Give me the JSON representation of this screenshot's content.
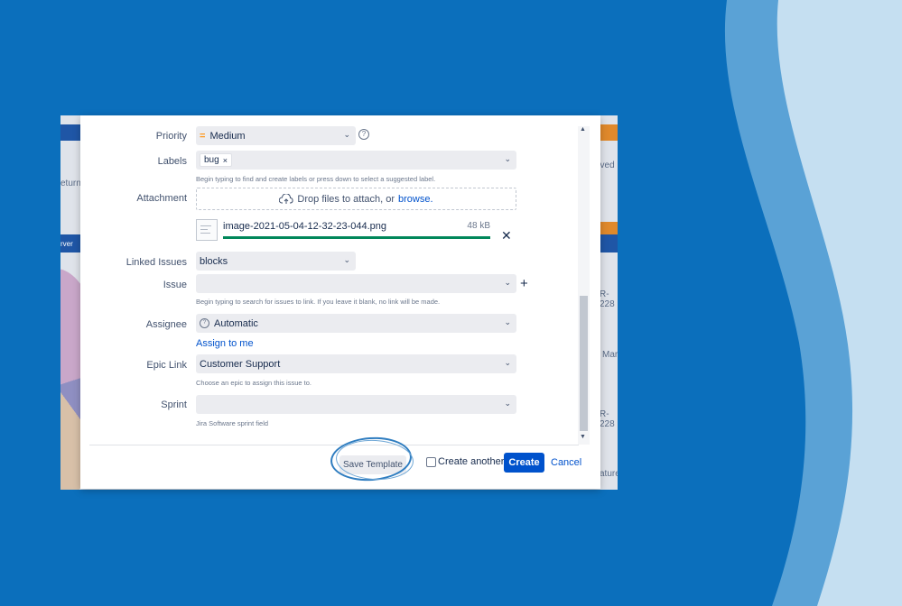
{
  "colors": {
    "background": "#0b6fbc",
    "accent": "#0052cc",
    "progress": "#00875a"
  },
  "background_app": {
    "snippets": [
      "eturn",
      "rver",
      "eved",
      "R-228",
      "Marl",
      "R-228",
      "ature"
    ]
  },
  "form": {
    "priority": {
      "label": "Priority",
      "value": "Medium",
      "icon": "priority-medium-icon"
    },
    "labels": {
      "label": "Labels",
      "tag": "bug",
      "tag_remove": "×",
      "hint": "Begin typing to find and create labels or press down to select a suggested label."
    },
    "attachment": {
      "label": "Attachment",
      "drop_text": "Drop files to attach, or",
      "browse": "browse.",
      "file": {
        "name": "image-2021-05-04-12-32-23-044.png",
        "size": "48 kB",
        "progress": 1.0
      },
      "remove": "✕"
    },
    "linked_issues": {
      "label": "Linked Issues",
      "value": "blocks"
    },
    "issue": {
      "label": "Issue",
      "value": "",
      "hint": "Begin typing to search for issues to link. If you leave it blank, no link will be made.",
      "add": "+"
    },
    "assignee": {
      "label": "Assignee",
      "value": "Automatic",
      "assign_to_me": "Assign to me"
    },
    "epic_link": {
      "label": "Epic Link",
      "value": "Customer Support",
      "hint": "Choose an epic to assign this issue to."
    },
    "sprint": {
      "label": "Sprint",
      "value": "",
      "hint": "Jira Software sprint field"
    }
  },
  "footer": {
    "save_template": "Save Template",
    "create_another": "Create another",
    "create_another_checked": false,
    "create": "Create",
    "cancel": "Cancel"
  },
  "icons": {
    "help": "?",
    "chevron": "⌄",
    "scroll_up": "▲",
    "scroll_down": "▼"
  }
}
